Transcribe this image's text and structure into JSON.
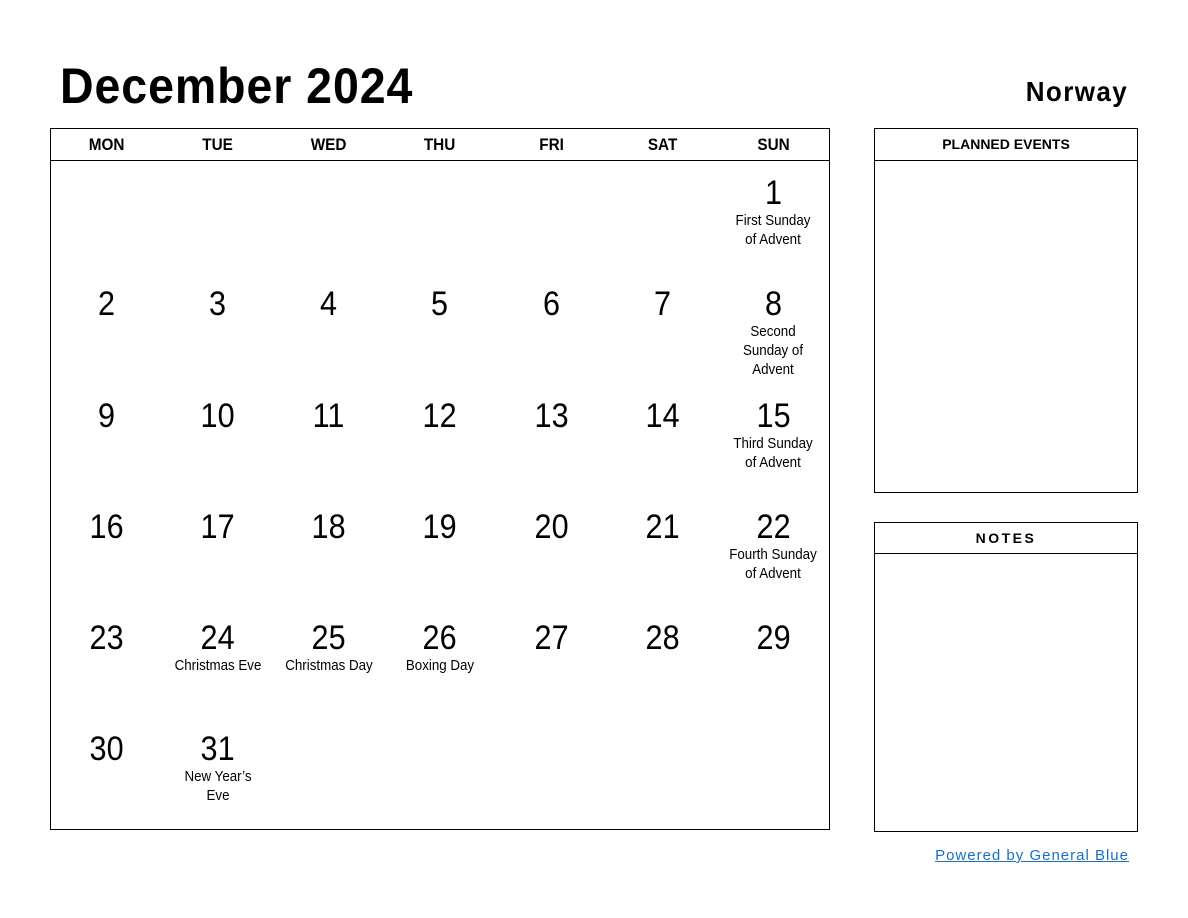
{
  "header": {
    "title": "December 2024",
    "country": "Norway"
  },
  "weekdays": [
    "MON",
    "TUE",
    "WED",
    "THU",
    "FRI",
    "SAT",
    "SUN"
  ],
  "weeks": [
    [
      {
        "day": ""
      },
      {
        "day": ""
      },
      {
        "day": ""
      },
      {
        "day": ""
      },
      {
        "day": ""
      },
      {
        "day": ""
      },
      {
        "day": "1",
        "event": "First Sunday of Advent"
      }
    ],
    [
      {
        "day": "2"
      },
      {
        "day": "3"
      },
      {
        "day": "4"
      },
      {
        "day": "5"
      },
      {
        "day": "6"
      },
      {
        "day": "7"
      },
      {
        "day": "8",
        "event": "Second Sunday of Advent"
      }
    ],
    [
      {
        "day": "9"
      },
      {
        "day": "10"
      },
      {
        "day": "11"
      },
      {
        "day": "12"
      },
      {
        "day": "13"
      },
      {
        "day": "14"
      },
      {
        "day": "15",
        "event": "Third Sunday of Advent"
      }
    ],
    [
      {
        "day": "16"
      },
      {
        "day": "17"
      },
      {
        "day": "18"
      },
      {
        "day": "19"
      },
      {
        "day": "20"
      },
      {
        "day": "21"
      },
      {
        "day": "22",
        "event": "Fourth Sunday of Advent"
      }
    ],
    [
      {
        "day": "23"
      },
      {
        "day": "24",
        "event": "Christmas Eve"
      },
      {
        "day": "25",
        "event": "Christmas Day"
      },
      {
        "day": "26",
        "event": "Boxing Day"
      },
      {
        "day": "27"
      },
      {
        "day": "28"
      },
      {
        "day": "29"
      }
    ],
    [
      {
        "day": "30"
      },
      {
        "day": "31",
        "event": "New Year’s Eve"
      },
      {
        "day": ""
      },
      {
        "day": ""
      },
      {
        "day": ""
      },
      {
        "day": ""
      },
      {
        "day": ""
      }
    ]
  ],
  "panels": {
    "planned_events": "PLANNED EVENTS",
    "notes": "NOTES"
  },
  "footer": {
    "powered_by": "Powered by General Blue",
    "link_color": "#1a6fc4"
  }
}
